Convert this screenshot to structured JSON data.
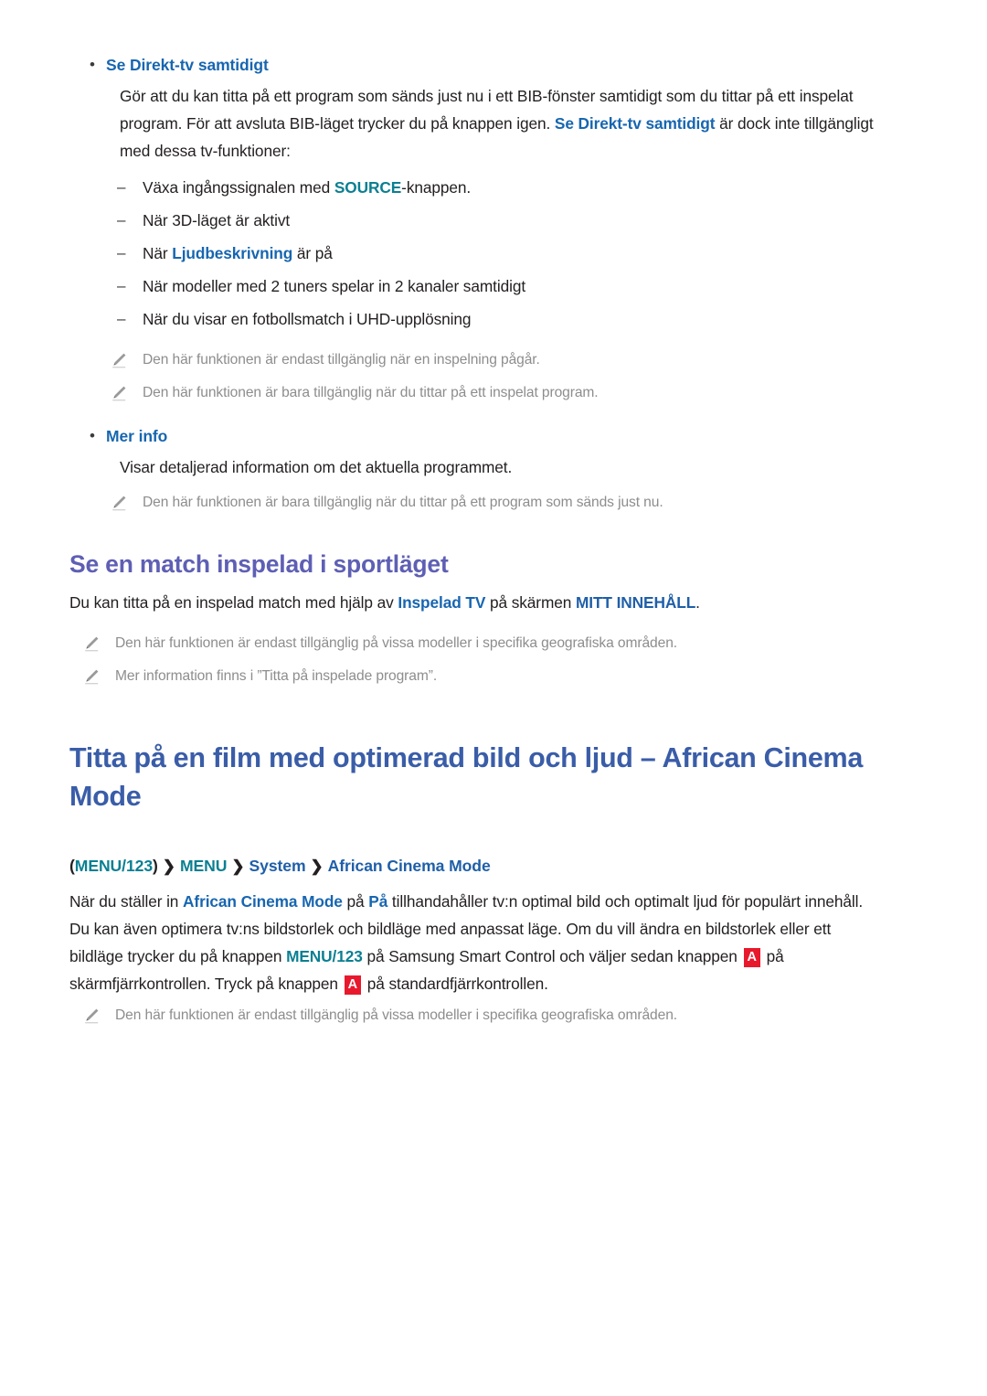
{
  "colors": {
    "link_blue": "#1766b0",
    "teal": "#0b7f92",
    "navy": "#1f5fa8",
    "heading_purple": "#5e5fb4",
    "heading_blue": "#3a5da8",
    "note_gray": "#8d8d8d",
    "key_red": "#e8192c",
    "body": "#231f20"
  },
  "section_live_tv": {
    "bullet_label": "Se Direkt-tv samtidigt",
    "paragraph": {
      "part1": "Gör att du kan titta på ett program som sänds just nu i ett BIB-fönster samtidigt som du tittar på ett inspelat program. För att avsluta BIB-läget trycker du på knappen igen. ",
      "highlight": "Se Direkt-tv samtidigt",
      "part2": " är dock inte tillgängligt med dessa tv-funktioner:"
    },
    "dash_items": [
      {
        "pre": "Växa ingångssignalen med ",
        "highlight": "SOURCE",
        "highlight_style": "teal",
        "post": "-knappen."
      },
      {
        "pre": "När 3D-läget är aktivt",
        "highlight": "",
        "highlight_style": "",
        "post": ""
      },
      {
        "pre": "När ",
        "highlight": "Ljudbeskrivning",
        "highlight_style": "blue",
        "post": " är på"
      },
      {
        "pre": "När modeller med 2 tuners spelar in 2 kanaler samtidigt",
        "highlight": "",
        "highlight_style": "",
        "post": ""
      },
      {
        "pre": "När du visar en fotbollsmatch i UHD-upplösning",
        "highlight": "",
        "highlight_style": "",
        "post": ""
      }
    ],
    "notes": [
      "Den här funktionen är endast tillgänglig när en inspelning pågår.",
      "Den här funktionen är bara tillgänglig när du tittar på ett inspelat program."
    ]
  },
  "section_more_info": {
    "bullet_label": "Mer info",
    "paragraph": "Visar detaljerad information om det aktuella programmet.",
    "notes": [
      "Den här funktionen är bara tillgänglig när du tittar på ett program som sänds just nu."
    ]
  },
  "section_sports": {
    "heading": "Se en match inspelad i sportläget",
    "paragraph": {
      "part1": "Du kan titta på en inspelad match med hjälp av ",
      "highlight1": "Inspelad TV",
      "part2": " på skärmen ",
      "highlight2": "MITT INNEHÅLL",
      "part3": "."
    },
    "notes": [
      "Den här funktionen är endast tillgänglig på vissa modeller i specifika geografiska områden.",
      "Mer information finns i ”Titta på inspelade program”."
    ]
  },
  "section_african_cinema": {
    "title": "Titta på en film med optimerad bild och ljud – African Cinema Mode",
    "breadcrumb": {
      "open_paren": "(",
      "item1": "MENU/123",
      "close_paren": ")",
      "sep": "❯",
      "item2": "MENU",
      "item3": "System",
      "item4": "African Cinema Mode"
    },
    "paragraph": {
      "p1": "När du ställer in ",
      "h1": "African Cinema Mode",
      "p2": " på ",
      "h2": "På",
      "p3": " tillhandahåller tv:n optimal bild och optimalt ljud för populärt innehåll. Du kan även optimera tv:ns bildstorlek och bildläge med anpassat läge. Om du vill ändra en bildstorlek eller ett bildläge trycker du på knappen ",
      "h3": "MENU/123",
      "p4": " på Samsung Smart Control och väljer sedan knappen ",
      "key1": "A",
      "p5": " på skärmfjärrkontrollen. Tryck på knappen ",
      "key2": "A",
      "p6": " på standardfjärrkontrollen."
    },
    "notes": [
      "Den här funktionen är endast tillgänglig på vissa modeller i specifika geografiska områden."
    ]
  },
  "icons": {
    "pencil": "pencil-icon",
    "bullet": "•",
    "dash": "–",
    "chevron": "❯"
  }
}
